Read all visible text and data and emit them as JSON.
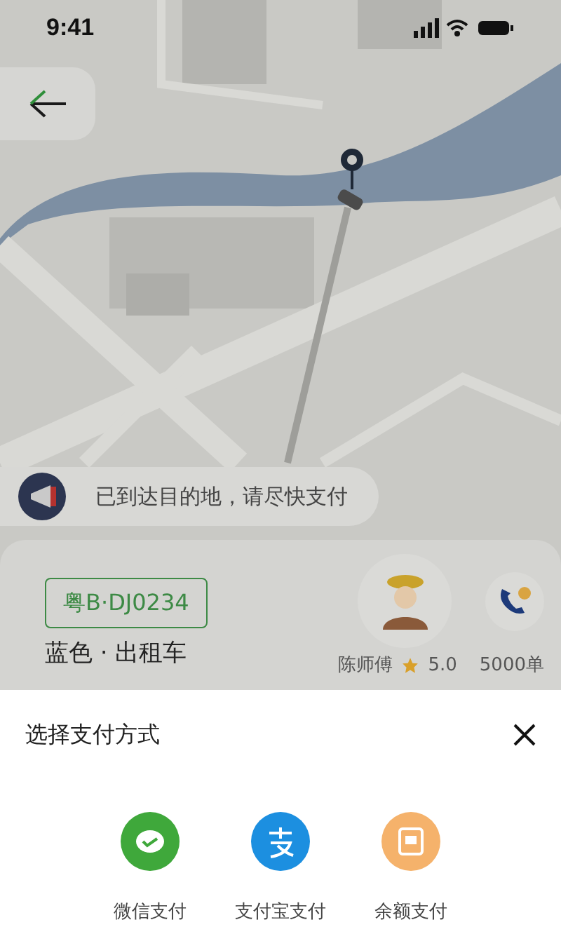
{
  "status_bar": {
    "time": "9:41"
  },
  "notice": {
    "text": "已到达目的地，请尽快支付"
  },
  "vehicle": {
    "plate": "粤B·DJ0234",
    "description": "蓝色 · 出租车"
  },
  "driver": {
    "name": "陈师傅",
    "rating": "5.0",
    "orders": "5000单"
  },
  "payment_sheet": {
    "title": "选择支付方式",
    "methods": [
      {
        "kind": "wechat",
        "label": "微信支付"
      },
      {
        "kind": "alipay",
        "label": "支付宝支付"
      },
      {
        "kind": "balance",
        "label": "余额支付"
      }
    ]
  }
}
